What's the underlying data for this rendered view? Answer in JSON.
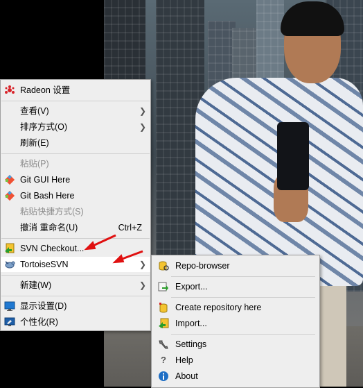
{
  "context_menu": {
    "items": [
      {
        "label": "Radeon 设置",
        "icon": "radeon-icon"
      },
      {
        "label": "查看(V)",
        "icon": "",
        "has_submenu": true
      },
      {
        "label": "排序方式(O)",
        "icon": "",
        "has_submenu": true
      },
      {
        "label": "刷新(E)",
        "icon": ""
      },
      {
        "label": "粘贴(P)",
        "icon": "",
        "disabled": true
      },
      {
        "label": "Git GUI Here",
        "icon": "git-icon"
      },
      {
        "label": "Git Bash Here",
        "icon": "git-icon"
      },
      {
        "label": "粘贴快捷方式(S)",
        "icon": "",
        "disabled": true
      },
      {
        "label": "撤消 重命名(U)",
        "shortcut": "Ctrl+Z"
      },
      {
        "label": "SVN Checkout...",
        "icon": "svn-checkout-icon"
      },
      {
        "label": "TortoiseSVN",
        "icon": "tortoise-icon",
        "has_submenu": true,
        "highlighted": true
      },
      {
        "label": "新建(W)",
        "has_submenu": true
      },
      {
        "label": "显示设置(D)",
        "icon": "display-icon"
      },
      {
        "label": "个性化(R)",
        "icon": "personalize-icon"
      }
    ]
  },
  "tortoise_submenu": {
    "items": [
      {
        "label": "Repo-browser",
        "icon": "repo-browser-icon"
      },
      {
        "label": "Export...",
        "icon": "export-icon"
      },
      {
        "label": "Create repository here",
        "icon": "create-repo-icon"
      },
      {
        "label": "Import...",
        "icon": "import-icon"
      },
      {
        "label": "Settings",
        "icon": "settings-icon"
      },
      {
        "label": "Help",
        "icon": "help-icon"
      },
      {
        "label": "About",
        "icon": "about-icon"
      }
    ]
  },
  "colors": {
    "menu_bg": "#eeeeee",
    "highlight": "#ffffff",
    "annotation_arrow": "#e01010"
  }
}
